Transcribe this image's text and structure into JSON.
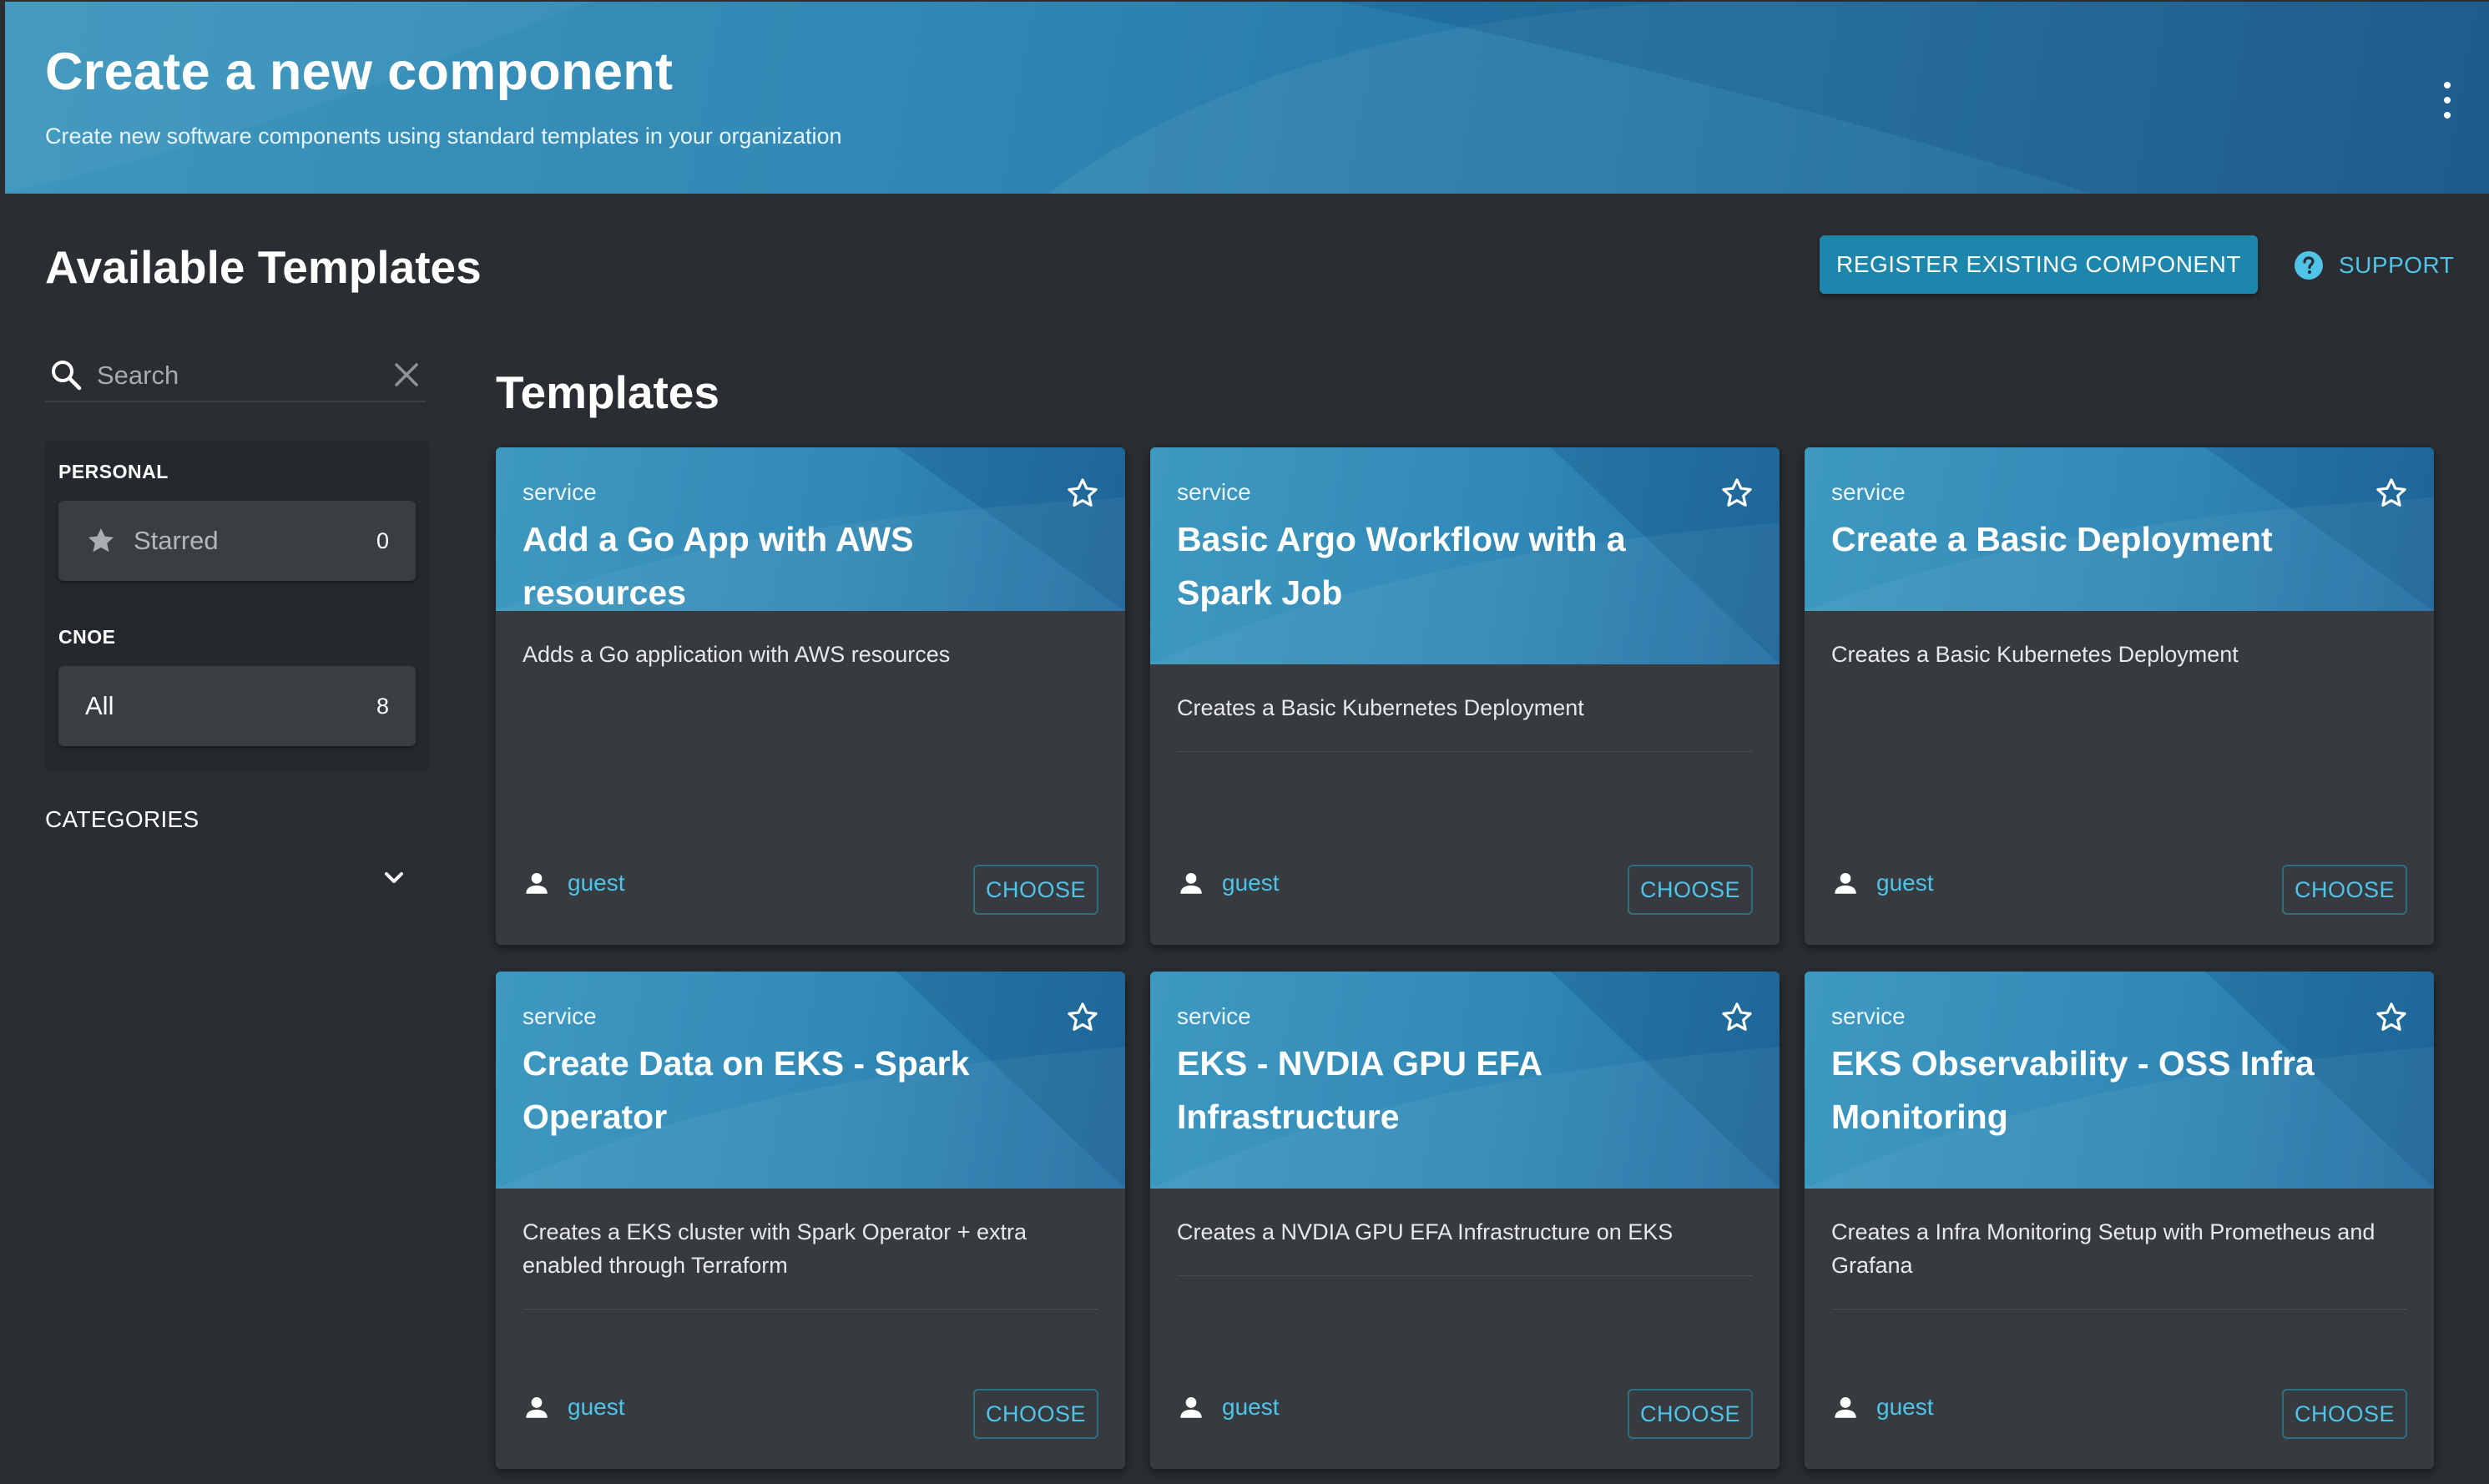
{
  "header": {
    "title": "Create a new component",
    "subtitle": "Create new software components using standard templates in your organization"
  },
  "toolbar": {
    "page_title": "Available Templates",
    "register_label": "REGISTER EXISTING COMPONENT",
    "support_label": "SUPPORT"
  },
  "sidebar": {
    "search": {
      "placeholder": "Search",
      "value": ""
    },
    "groups": [
      {
        "title": "PERSONAL",
        "items": [
          {
            "label": "Starred",
            "count": "0"
          }
        ]
      },
      {
        "title": "CNOE",
        "items": [
          {
            "label": "All",
            "count": "8"
          }
        ]
      }
    ],
    "categories_title": "CATEGORIES"
  },
  "main": {
    "section_title": "Templates",
    "cards": [
      {
        "type": "service",
        "title": "Add a Go App with AWS resources",
        "description": "Adds a Go application with AWS resources",
        "owner": "guest",
        "action": "CHOOSE"
      },
      {
        "type": "service",
        "title": "Basic Argo Workflow with a Spark Job",
        "description": "Creates a Basic Kubernetes Deployment",
        "owner": "guest",
        "action": "CHOOSE"
      },
      {
        "type": "service",
        "title": "Create a Basic Deployment",
        "description": "Creates a Basic Kubernetes Deployment",
        "owner": "guest",
        "action": "CHOOSE"
      },
      {
        "type": "service",
        "title": "Create Data on EKS - Spark Operator",
        "description": "Creates a EKS cluster with Spark Operator + extra enabled through Terraform",
        "owner": "guest",
        "action": "CHOOSE"
      },
      {
        "type": "service",
        "title": "EKS - NVDIA GPU EFA Infrastructure",
        "description": "Creates a NVDIA GPU EFA Infrastructure on EKS",
        "owner": "guest",
        "action": "CHOOSE"
      },
      {
        "type": "service",
        "title": "EKS Observability - OSS Infra Monitoring",
        "description": "Creates a Infra Monitoring Setup with Prometheus and Grafana",
        "owner": "guest",
        "action": "CHOOSE"
      }
    ]
  },
  "theme": {
    "background": "#2a2d31",
    "card": "#373b40",
    "accent": "#4fc3e8",
    "primary_button": "#1d86ad",
    "header_gradient": [
      "#3d96bd",
      "#15598c"
    ]
  },
  "icons": {
    "header_menu": "more-vert-icon",
    "support": "help-circle-icon",
    "search": "search-icon",
    "clear": "close-icon",
    "starred": "star-icon",
    "favorite": "star-outline-icon",
    "owner": "person-icon",
    "categories": "chevron-down-icon"
  }
}
